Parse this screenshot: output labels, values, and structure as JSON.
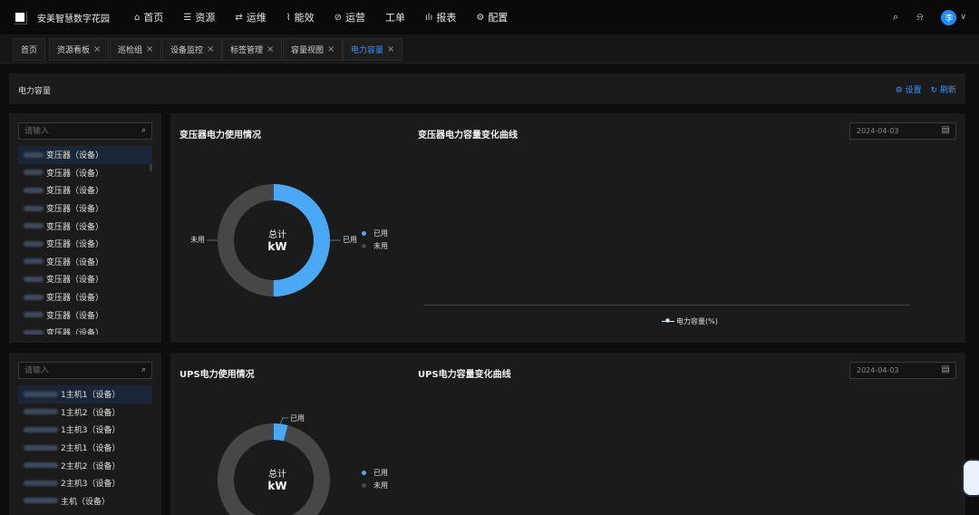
{
  "app": {
    "brand": "安美智慧数字花园"
  },
  "nav": [
    {
      "icon": "⌂",
      "label": "首页"
    },
    {
      "icon": "☰",
      "label": "资源"
    },
    {
      "icon": "⇄",
      "label": "运维"
    },
    {
      "icon": "⌇",
      "label": "能效"
    },
    {
      "icon": "⊘",
      "label": "运营"
    },
    {
      "icon": "",
      "label": "工单"
    },
    {
      "icon": "ılı",
      "label": "报表"
    },
    {
      "icon": "⚙",
      "label": "配置"
    }
  ],
  "user": {
    "avatar": "李"
  },
  "tabs": [
    {
      "label": "首页",
      "closable": false
    },
    {
      "label": "资源看板",
      "closable": true
    },
    {
      "label": "巡检组",
      "closable": true
    },
    {
      "label": "设备监控",
      "closable": true
    },
    {
      "label": "标签管理",
      "closable": true
    },
    {
      "label": "容量视图",
      "closable": true
    },
    {
      "label": "电力容量",
      "closable": true,
      "active": true
    }
  ],
  "section": {
    "title": "电力容量",
    "settings": "⚙ 设置",
    "refresh": "↻ 刷新"
  },
  "transformer": {
    "search_placeholder": "请输入",
    "items": [
      "变压器（设备）",
      "变压器（设备）",
      "变压器（设备）",
      "变压器（设备）",
      "变压器（设备）",
      "变压器（设备）",
      "变压器（设备）",
      "变压器（设备）",
      "变压器（设备）",
      "变压器（设备）",
      "变压器（设备）"
    ],
    "usage_title": "变压器电力使用情况",
    "curve_title": "变压器电力容量变化曲线",
    "date": "2024-04-03",
    "center_title": "总计",
    "center_value": "kW",
    "used_label": "已用",
    "unused_label": "未用",
    "used_ratio": 0.5,
    "legend_used": "已用",
    "legend_unused": "未用",
    "chart_legend": "电力容量(%)"
  },
  "ups": {
    "search_placeholder": "请输入",
    "items": [
      "1主机1（设备）",
      "1主机2（设备）",
      "1主机3（设备）",
      "2主机1（设备）",
      "2主机2（设备）",
      "2主机3（设备）",
      "主机（设备）"
    ],
    "usage_title": "UPS电力使用情况",
    "curve_title": "UPS电力容量变化曲线",
    "date": "2024-04-03",
    "center_title": "总计",
    "center_value": "kW",
    "used_label": "已用",
    "used_ratio": 0.04,
    "legend_used": "已用",
    "legend_unused": "未用"
  },
  "colors": {
    "used": "#4aa8f4",
    "unused": "#474747",
    "accent": "#3b95ff"
  }
}
